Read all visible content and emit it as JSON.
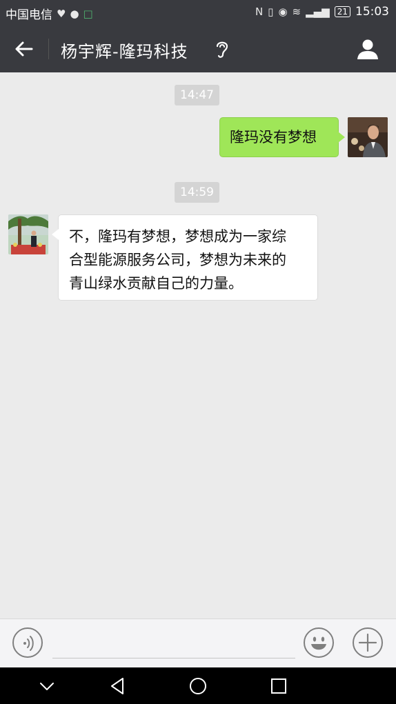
{
  "status_bar": {
    "carrier": "中国电信",
    "battery": "21",
    "time": "15:03"
  },
  "header": {
    "title": "杨宇辉-隆玛科技"
  },
  "messages": [
    {
      "type": "time",
      "text": "14:47"
    },
    {
      "type": "sent",
      "text": "隆玛没有梦想"
    },
    {
      "type": "time",
      "text": "14:59"
    },
    {
      "type": "received",
      "lines": [
        "不，隆玛有梦想，梦想成为一家综",
        "合型能源服务公司，梦想为未来的",
        "青山绿水贡献自己的力量。"
      ]
    }
  ],
  "colors": {
    "header_bg": "#393a3f",
    "chat_bg": "#ebebeb",
    "sent_bubble": "#9fe658",
    "received_bubble": "#ffffff"
  },
  "icons": [
    "back-arrow-icon",
    "earpiece-icon",
    "profile-icon",
    "voice-icon",
    "emoji-icon",
    "plus-icon",
    "nav-down-icon",
    "nav-back-icon",
    "nav-home-icon",
    "nav-recents-icon"
  ]
}
